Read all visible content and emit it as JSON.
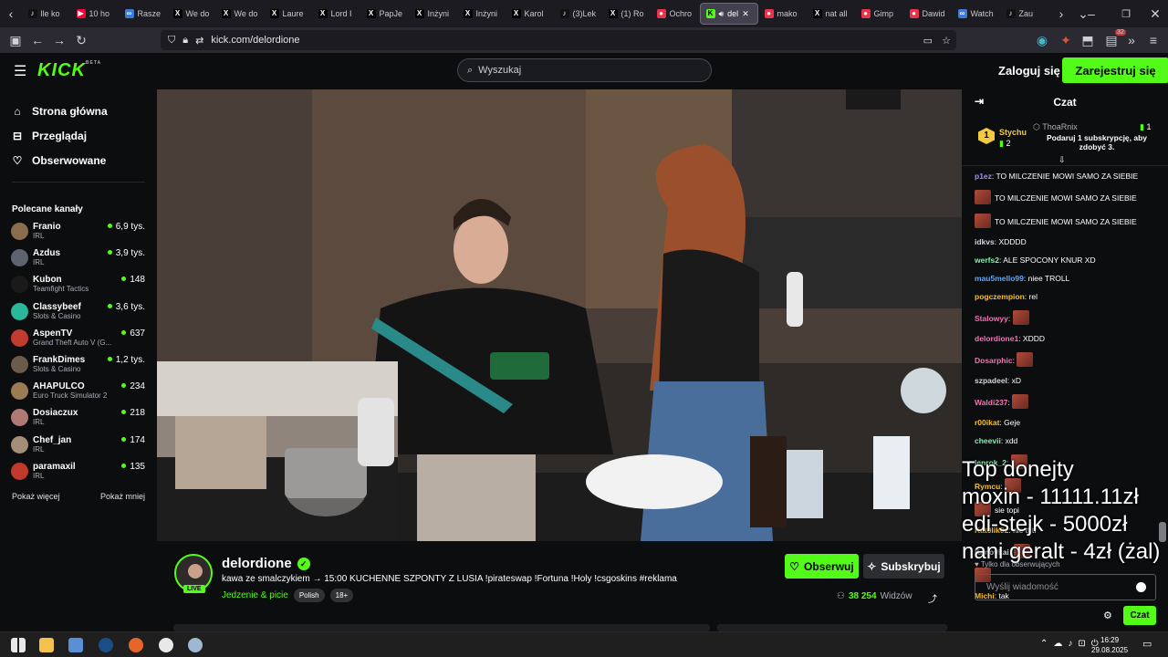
{
  "browser": {
    "tabs": [
      {
        "label": "lle ko",
        "icon": "tiktok"
      },
      {
        "label": "10 ho",
        "icon": "youtube"
      },
      {
        "label": "Rasze",
        "icon": "generic"
      },
      {
        "label": "We do",
        "icon": "x"
      },
      {
        "label": "We do",
        "icon": "x"
      },
      {
        "label": "Laure",
        "icon": "x"
      },
      {
        "label": "Lord I",
        "icon": "x"
      },
      {
        "label": "PapJe",
        "icon": "x"
      },
      {
        "label": "Inżyni",
        "icon": "x"
      },
      {
        "label": "Inżyni",
        "icon": "x"
      },
      {
        "label": "Karol",
        "icon": "x"
      },
      {
        "label": "(3)Lek",
        "icon": "tiktok"
      },
      {
        "label": "(1) Ro",
        "icon": "x"
      },
      {
        "label": "Ochro",
        "icon": "red"
      },
      {
        "label": "del",
        "icon": "kick",
        "active": true
      },
      {
        "label": "mako",
        "icon": "red"
      },
      {
        "label": "nat all",
        "icon": "x"
      },
      {
        "label": "Gimp",
        "icon": "red"
      },
      {
        "label": "Dawid",
        "icon": "red"
      },
      {
        "label": "Watch",
        "icon": "generic"
      },
      {
        "label": "Zau",
        "icon": "tiktok"
      }
    ],
    "url": "kick.com/delordione",
    "notification_count": "32"
  },
  "header": {
    "logo": "KICK",
    "logo_badge": "BETA",
    "search_placeholder": "Wyszukaj",
    "login": "Zaloguj się",
    "register": "Zarejestruj się"
  },
  "sidebar": {
    "nav": [
      {
        "label": "Strona główna",
        "icon": "home-icon"
      },
      {
        "label": "Przeglądaj",
        "icon": "browse-icon"
      },
      {
        "label": "Obserwowane",
        "icon": "heart-icon"
      }
    ],
    "recommended_title": "Polecane kanały",
    "channels": [
      {
        "name": "Franio",
        "category": "IRL",
        "viewers": "6,9 tys.",
        "color": "#8a6d4f"
      },
      {
        "name": "Azdus",
        "category": "IRL",
        "viewers": "3,9 tys.",
        "color": "#5d6470"
      },
      {
        "name": "Kubon",
        "category": "Teamfight Tactics",
        "viewers": "148",
        "color": "#1a1a1a"
      },
      {
        "name": "Classybeef",
        "category": "Slots & Casino",
        "viewers": "3,6 tys.",
        "color": "#2bb89a"
      },
      {
        "name": "AspenTV",
        "category": "Grand Theft Auto V (G...",
        "viewers": "637",
        "color": "#c23b2f"
      },
      {
        "name": "FrankDimes",
        "category": "Slots & Casino",
        "viewers": "1,2 tys.",
        "color": "#6b5b4b"
      },
      {
        "name": "AHAPULCO",
        "category": "Euro Truck Simulator 2",
        "viewers": "234",
        "color": "#9b7a54"
      },
      {
        "name": "Dosiaczux",
        "category": "IRL",
        "viewers": "218",
        "color": "#b07a74"
      },
      {
        "name": "Chef_jan",
        "category": "IRL",
        "viewers": "174",
        "color": "#a58d77"
      },
      {
        "name": "paramaxil",
        "category": "IRL",
        "viewers": "135",
        "color": "#c0392b"
      }
    ],
    "show_more": "Pokaż więcej",
    "show_less": "Pokaż mniej"
  },
  "stream": {
    "streamer": "delordione",
    "live_badge": "LIVE",
    "title": "kawa ze smalczykiem → 15:00 KUCHENNE SZPONTY Z LUSIA !pirateswap !Fortuna !Holy !csgoskins #reklama",
    "category": "Jedzenie & picie",
    "tags": [
      "Polish",
      "18+"
    ],
    "follow": "Obserwuj",
    "subscribe": "Subskrybuj",
    "viewers": "38 254",
    "viewers_label": "Widzów"
  },
  "chat": {
    "title": "Czat",
    "pinned": {
      "rank": "1",
      "top_user": "Stychu",
      "top_count": "2",
      "gifter": "ThoaRnix",
      "gifter_count": "1",
      "gift_message": "Podaruj 1 subskrypcję, aby zdobyć 3."
    },
    "messages": [
      {
        "user": "p1ez",
        "text": "TO MILCZENIE MOWI SAMO ZA SIEBIE",
        "color": "#a78bfa"
      },
      {
        "user": "",
        "text": "TO MILCZENIE MOWI SAMO ZA SIEBIE",
        "color": "#a78bfa"
      },
      {
        "user": "",
        "text": "TO MILCZENIE MOWI SAMO ZA SIEBIE",
        "color": "#a78bfa"
      },
      {
        "user": "idkvs",
        "text": "XDDDD",
        "color": "#d1d5db"
      },
      {
        "user": "werfs2",
        "text": "ALE SPOCONY KNUR XD",
        "color": "#86efac"
      },
      {
        "user": "mau5mello99",
        "text": "niee TROLL",
        "color": "#60a5fa"
      },
      {
        "user": "pogczempion",
        "text": "rel",
        "color": "#fbbf24"
      },
      {
        "user": "Stalowyy",
        "text": "",
        "color": "#f472b6"
      },
      {
        "user": "delordione1",
        "text": "XDDD",
        "color": "#f472b6"
      },
      {
        "user": "Dosarphic",
        "text": "",
        "color": "#f472b6"
      },
      {
        "user": "szpadeel",
        "text": "xD",
        "color": "#d1d5db"
      },
      {
        "user": "Waldi237",
        "text": "",
        "color": "#f472b6"
      },
      {
        "user": "r00ikat",
        "text": "Geje",
        "color": "#fbbf24"
      },
      {
        "user": "cheevii",
        "text": "xdd",
        "color": "#86efac"
      },
      {
        "user": "lenrok_2",
        "text": "",
        "color": "#86efac"
      },
      {
        "user": "Rymcu",
        "text": "",
        "color": "#fbbf24"
      },
      {
        "user": "",
        "text": "sie topi",
        "color": "#d1d5db"
      },
      {
        "user": "Kat0lik02",
        "text": "nie tf tf",
        "color": "#fbbf24"
      },
      {
        "user": "Kanovkai",
        "text": "",
        "color": "#d1d5db"
      },
      {
        "user": "",
        "text": "",
        "color": "#d1d5db"
      },
      {
        "user": "Michi",
        "text": "tak",
        "color": "#fbbf24"
      }
    ],
    "overlay_lines": [
      "Top donejty",
      "moxin - 11111.11zł",
      "edi-stejk - 5000zł",
      "nani geralt - 4zł (żal)"
    ],
    "followers_only": "Tylko dla obserwujących",
    "input_placeholder": "Wyślij wiadomość",
    "send": "Czat"
  },
  "taskbar": {
    "time": "16:29",
    "date": "29.08.2025"
  }
}
